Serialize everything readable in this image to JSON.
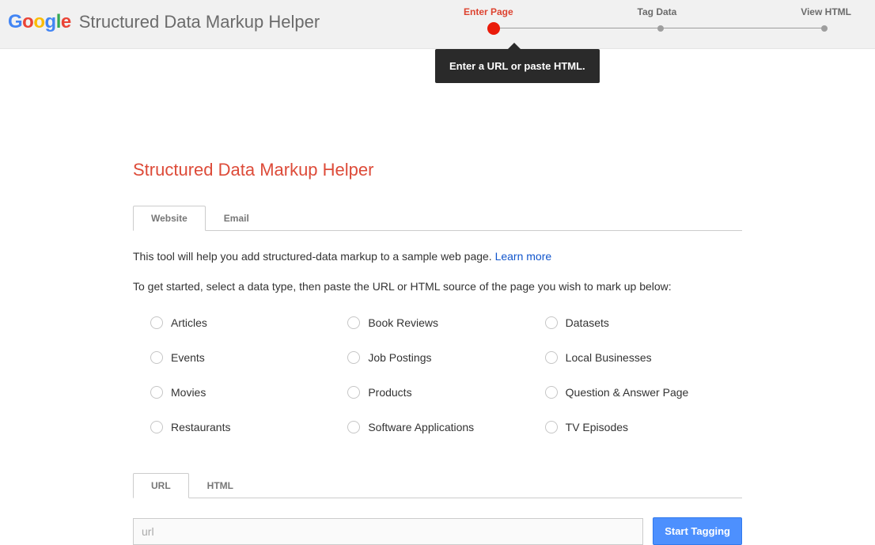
{
  "header": {
    "logo_text": "Google",
    "product_title": "Structured Data Markup Helper"
  },
  "stepper": {
    "steps": [
      "Enter Page",
      "Tag Data",
      "View HTML"
    ],
    "active_index": 0,
    "tooltip_text": "Enter a URL or paste HTML."
  },
  "main": {
    "page_title": "Structured Data Markup Helper",
    "tabs_top": {
      "items": [
        "Website",
        "Email"
      ],
      "active_index": 0
    },
    "intro_text": "This tool will help you add structured-data markup to a sample web page. ",
    "intro_link": "Learn more",
    "instructions": "To get started, select a data type, then paste the URL or HTML source of the page you wish to mark up below:",
    "data_types": [
      "Articles",
      "Book Reviews",
      "Datasets",
      "Events",
      "Job Postings",
      "Local Businesses",
      "Movies",
      "Products",
      "Question & Answer Page",
      "Restaurants",
      "Software Applications",
      "TV Episodes"
    ],
    "tabs_input": {
      "items": [
        "URL",
        "HTML"
      ],
      "active_index": 0
    },
    "url_placeholder": "url",
    "start_button": "Start Tagging"
  }
}
